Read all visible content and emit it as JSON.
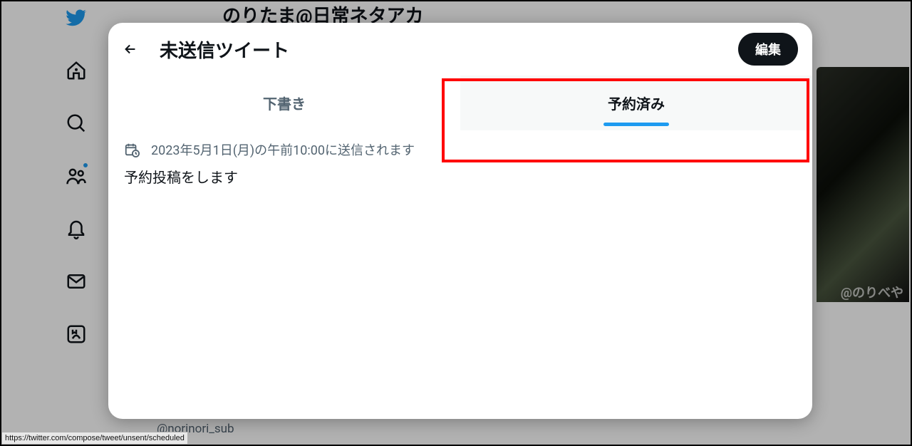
{
  "background": {
    "profile_title_partial": "のりたま@日常ネタアカ",
    "handle_partial": "@norinori_sub",
    "media_badge": "@のりべや"
  },
  "modal": {
    "title": "未送信ツイート",
    "edit_label": "編集",
    "tabs": {
      "drafts_label": "下書き",
      "scheduled_label": "予約済み",
      "active": "scheduled"
    },
    "scheduled_item": {
      "meta": "2023年5月1日(月)の午前10:00に送信されます",
      "body": "予約投稿をします"
    }
  },
  "status_bar": "https://twitter.com/compose/tweet/unsent/scheduled",
  "icons": {
    "back": "arrow-left-icon",
    "schedule": "calendar-clock-icon"
  }
}
